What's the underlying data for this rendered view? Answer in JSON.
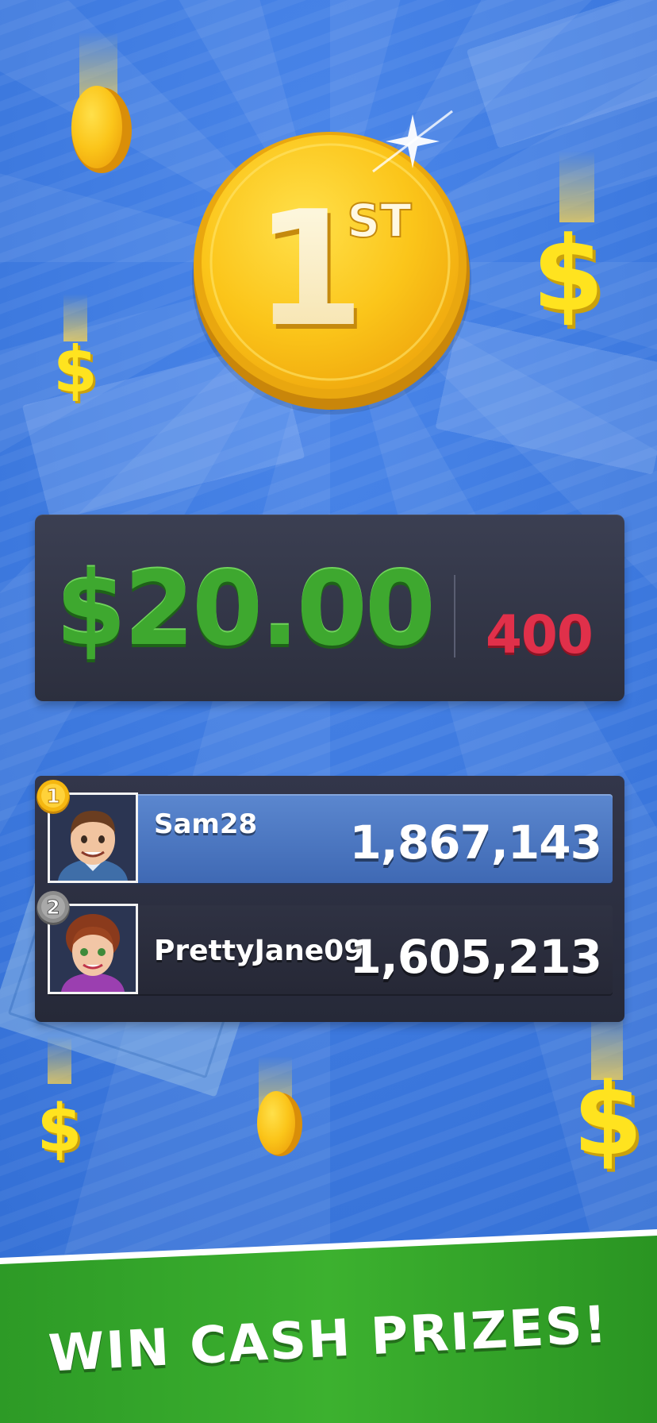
{
  "colors": {
    "background": "#3f7be0",
    "gold": "#f7c21a",
    "prize_green": "#3ea82f",
    "points_red": "#e0304a",
    "panel": "#2f3242",
    "footer_green": "#35a52a"
  },
  "rank_coin": {
    "number": "1",
    "suffix": "ST"
  },
  "prize": {
    "amount": "$20.00",
    "points": "400"
  },
  "leaderboard": [
    {
      "rank": "1",
      "name": "Sam28",
      "score": "1,867,143",
      "badge_color": "#f5b711"
    },
    {
      "rank": "2",
      "name": "PrettyJane09",
      "score": "1,605,213",
      "badge_color": "#8d8d8d"
    }
  ],
  "footer": {
    "tagline": "WIN CASH PRIZES!"
  }
}
